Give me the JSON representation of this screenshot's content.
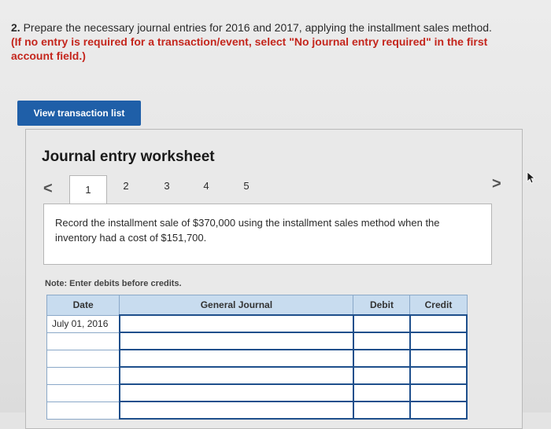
{
  "question": {
    "number": "2.",
    "text": "Prepare the necessary journal entries for 2016 and 2017, applying the installment sales method.",
    "hint": "(If no entry is required for a transaction/event, select \"No journal entry required\" in the first account field.)"
  },
  "view_button_label": "View transaction list",
  "worksheet": {
    "title": "Journal entry worksheet",
    "prev": "<",
    "next": ">",
    "tabs": [
      "1",
      "2",
      "3",
      "4",
      "5"
    ],
    "active_tab": "1",
    "description": "Record the installment sale of $370,000 using the installment sales method when the inventory had a cost of $151,700.",
    "note": "Note: Enter debits before credits."
  },
  "journal": {
    "headers": {
      "date": "Date",
      "account": "General Journal",
      "debit": "Debit",
      "credit": "Credit"
    },
    "rows": [
      {
        "date": "July 01, 2016",
        "account": "",
        "debit": "",
        "credit": ""
      },
      {
        "date": "",
        "account": "",
        "debit": "",
        "credit": ""
      },
      {
        "date": "",
        "account": "",
        "debit": "",
        "credit": ""
      },
      {
        "date": "",
        "account": "",
        "debit": "",
        "credit": ""
      },
      {
        "date": "",
        "account": "",
        "debit": "",
        "credit": ""
      },
      {
        "date": "",
        "account": "",
        "debit": "",
        "credit": ""
      }
    ]
  },
  "colors": {
    "button": "#1f5fa8",
    "hint": "#c4261d",
    "table_header": "#c8dcef",
    "cell_border": "#1e4f8c"
  },
  "icons": {
    "cursor": "mouse-pointer-icon"
  }
}
